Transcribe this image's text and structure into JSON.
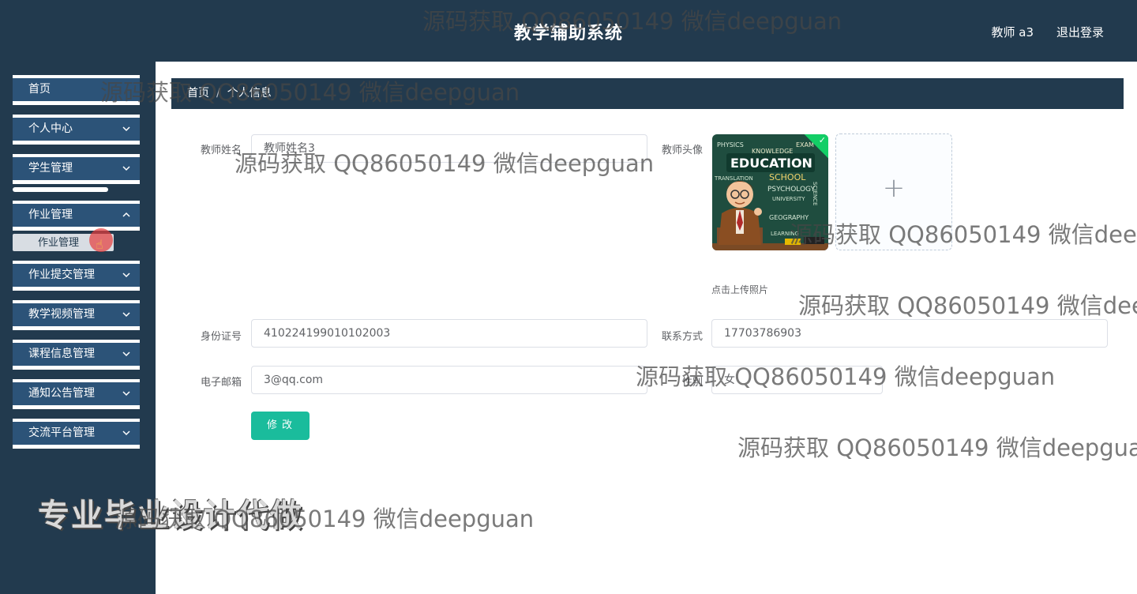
{
  "header": {
    "title": "教学辅助系统",
    "user": "教师 a3",
    "logout": "退出登录"
  },
  "sidebar": {
    "items": [
      {
        "label": "首页",
        "has_arrow": false
      },
      {
        "label": "个人中心",
        "has_arrow": true
      },
      {
        "label": "学生管理",
        "has_arrow": true
      },
      {
        "label": "作业管理",
        "has_arrow": true
      },
      {
        "label": "作业提交管理",
        "has_arrow": true
      },
      {
        "label": "教学视频管理",
        "has_arrow": true
      },
      {
        "label": "课程信息管理",
        "has_arrow": true
      },
      {
        "label": "通知公告管理",
        "has_arrow": true
      },
      {
        "label": "交流平台管理",
        "has_arrow": true
      }
    ],
    "submenu_item": "作业管理",
    "promo": "专业毕业设计代做"
  },
  "breadcrumb": {
    "home": "首页",
    "separator": "/",
    "current": "个人信息"
  },
  "form": {
    "name_label": "教师姓名",
    "name_value": "教师姓名3",
    "avatar_label": "教师头像",
    "upload_tip": "点击上传照片",
    "upload_plus": "+",
    "avatar_image": {
      "badge": "EDUCATION",
      "words": [
        "PHYSICS",
        "KNOWLEDGE",
        "EXAM",
        "SCHOOL",
        "PSYCHOLOGY",
        "UNIVERSITY",
        "GEOGRAPHY",
        "LEARNING",
        "SCIENCE",
        "TRANSLATION"
      ]
    },
    "id_label": "身份证号",
    "id_value": "410224199010102003",
    "phone_label": "联系方式",
    "phone_value": "17703786903",
    "email_label": "电子邮箱",
    "email_value": "3@qq.com",
    "gender_label": "性别",
    "gender_value": "女",
    "save_button": "修改"
  },
  "watermarks": {
    "text": "源码获取 QQ86050149 微信deepguan",
    "text_cut1": "源码获取 QQ86050149 微信dee",
    "text_cut2": "源码获取 QQ86050149 微信dee",
    "text_cut3": "源码获取 QQ86050149 微信deepgua"
  },
  "colors": {
    "header_bg": "#223a4e",
    "menu_item_bg": "#2c5378",
    "breadcrumb_bg": "#223a4e",
    "save_button_bg": "#1abc9c",
    "upload_success": "#13ce66"
  }
}
